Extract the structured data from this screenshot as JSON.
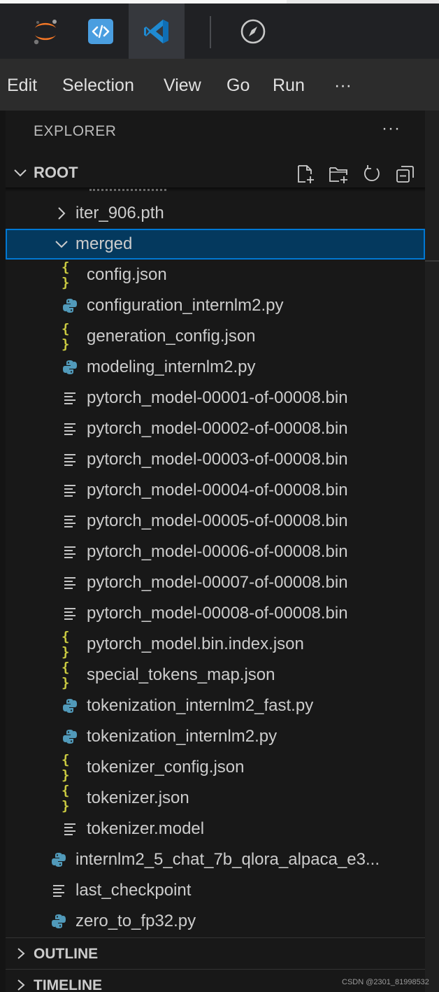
{
  "menu": [
    "Edit",
    "Selection",
    "View",
    "Go",
    "Run",
    "···"
  ],
  "apptabs": [
    {
      "icon": "jupyter-icon"
    },
    {
      "icon": "code-brackets-icon"
    },
    {
      "icon": "vscode-icon",
      "active": true
    },
    {
      "icon": "compass-icon"
    }
  ],
  "explorer": {
    "title": "EXPLORER",
    "more": "···",
    "root": "ROOT"
  },
  "tree": [
    {
      "label": "iter_906.pth",
      "type": "folder",
      "expanded": false,
      "indent": 1
    },
    {
      "label": "merged",
      "type": "folder",
      "expanded": true,
      "indent": 1,
      "selected": true
    },
    {
      "label": "config.json",
      "type": "json",
      "indent": 2
    },
    {
      "label": "configuration_internlm2.py",
      "type": "python",
      "indent": 2
    },
    {
      "label": "generation_config.json",
      "type": "json",
      "indent": 2
    },
    {
      "label": "modeling_internlm2.py",
      "type": "python",
      "indent": 2
    },
    {
      "label": "pytorch_model-00001-of-00008.bin",
      "type": "file",
      "indent": 2
    },
    {
      "label": "pytorch_model-00002-of-00008.bin",
      "type": "file",
      "indent": 2
    },
    {
      "label": "pytorch_model-00003-of-00008.bin",
      "type": "file",
      "indent": 2
    },
    {
      "label": "pytorch_model-00004-of-00008.bin",
      "type": "file",
      "indent": 2
    },
    {
      "label": "pytorch_model-00005-of-00008.bin",
      "type": "file",
      "indent": 2
    },
    {
      "label": "pytorch_model-00006-of-00008.bin",
      "type": "file",
      "indent": 2
    },
    {
      "label": "pytorch_model-00007-of-00008.bin",
      "type": "file",
      "indent": 2
    },
    {
      "label": "pytorch_model-00008-of-00008.bin",
      "type": "file",
      "indent": 2
    },
    {
      "label": "pytorch_model.bin.index.json",
      "type": "json",
      "indent": 2
    },
    {
      "label": "special_tokens_map.json",
      "type": "json",
      "indent": 2
    },
    {
      "label": "tokenization_internlm2_fast.py",
      "type": "python",
      "indent": 2
    },
    {
      "label": "tokenization_internlm2.py",
      "type": "python",
      "indent": 2
    },
    {
      "label": "tokenizer_config.json",
      "type": "json",
      "indent": 2
    },
    {
      "label": "tokenizer.json",
      "type": "json",
      "indent": 2
    },
    {
      "label": "tokenizer.model",
      "type": "file",
      "indent": 2
    },
    {
      "label": "internlm2_5_chat_7b_qlora_alpaca_e3...",
      "type": "python",
      "indent": 1
    },
    {
      "label": "last_checkpoint",
      "type": "file",
      "indent": 1
    },
    {
      "label": "zero_to_fp32.py",
      "type": "python",
      "indent": 1
    }
  ],
  "sections": [
    "OUTLINE",
    "TIMELINE"
  ],
  "watermark": "CSDN @2301_81998532",
  "colors": {
    "python": "#519aba",
    "json": "#cbcb41",
    "selection": "#04395e",
    "focus": "#0078d4"
  }
}
